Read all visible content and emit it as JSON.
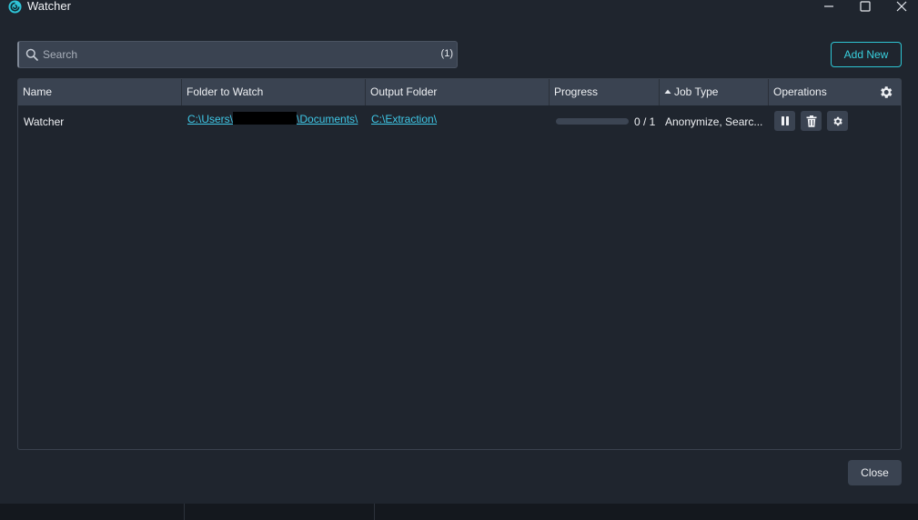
{
  "window": {
    "title": "Watcher",
    "accent_color": "#38cfdd"
  },
  "search": {
    "placeholder": "Search",
    "value": "",
    "count": "(1)"
  },
  "toolbar": {
    "add_new_label": "Add New"
  },
  "table": {
    "columns": {
      "name": "Name",
      "folder": "Folder to Watch",
      "output": "Output Folder",
      "progress": "Progress",
      "job_type": "Job Type",
      "operations": "Operations"
    },
    "sort": {
      "column": "job_type",
      "direction": "ascending"
    },
    "rows": [
      {
        "name": "Watcher",
        "folder_prefix": "C:\\Users\\",
        "folder_suffix": "\\Documents\\",
        "output": "C:\\Extraction\\",
        "progress_fraction": 0,
        "progress_text": "0 / 1",
        "job_type": "Anonymize, Searc..."
      }
    ]
  },
  "footer": {
    "close_label": "Close"
  },
  "icons": {
    "app": "watcher-logo-icon",
    "search": "search-icon",
    "settings": "gear-icon",
    "pause": "pause-icon",
    "delete": "trash-icon",
    "sort": "sort-up-icon"
  }
}
